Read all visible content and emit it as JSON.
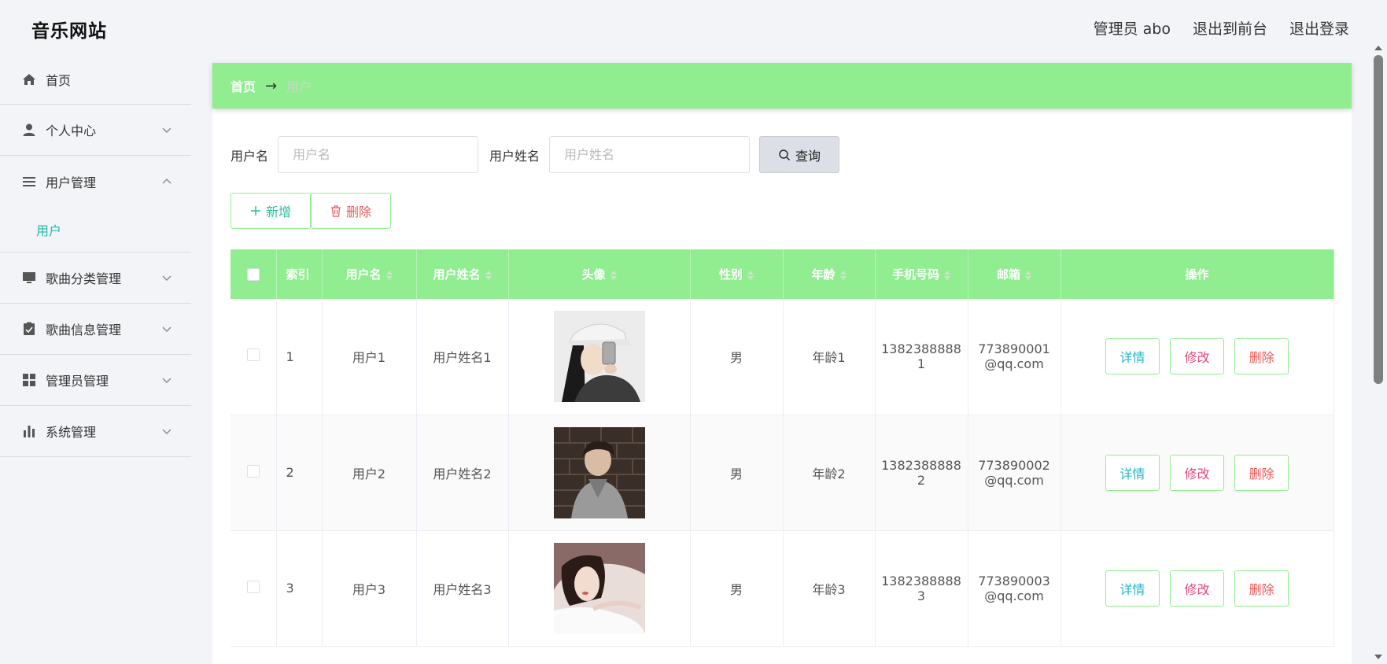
{
  "header": {
    "brand": "音乐网站",
    "admin_label": "管理员 abo",
    "to_front": "退出到前台",
    "logout": "退出登录"
  },
  "sidebar": {
    "items": [
      {
        "label": "首页",
        "icon": "home-icon"
      },
      {
        "label": "个人中心",
        "icon": "person-icon"
      },
      {
        "label": "用户管理",
        "icon": "list-icon",
        "open": true,
        "children": [
          "用户"
        ]
      },
      {
        "label": "歌曲分类管理",
        "icon": "monitor-icon"
      },
      {
        "label": "歌曲信息管理",
        "icon": "clipboard-icon"
      },
      {
        "label": "管理员管理",
        "icon": "grid-icon"
      },
      {
        "label": "系统管理",
        "icon": "bar-chart-icon"
      }
    ]
  },
  "breadcrumb": {
    "home": "首页",
    "arrow": "→",
    "current": "用户"
  },
  "search": {
    "username_label": "用户名",
    "username_placeholder": "用户名",
    "realname_label": "用户姓名",
    "realname_placeholder": "用户姓名",
    "query_button": "查询"
  },
  "actions": {
    "add": "新增",
    "delete": "删除"
  },
  "table": {
    "columns": [
      "索引",
      "用户名",
      "用户姓名",
      "头像",
      "性别",
      "年龄",
      "手机号码",
      "邮箱",
      "操作"
    ],
    "rows": [
      {
        "index": "1",
        "username": "用户1",
        "realname": "用户姓名1",
        "gender": "男",
        "age": "年龄1",
        "phone_a": "1382388888",
        "phone_b": "1",
        "email_a": "773890001",
        "email_b": "@qq.com"
      },
      {
        "index": "2",
        "username": "用户2",
        "realname": "用户姓名2",
        "gender": "男",
        "age": "年龄2",
        "phone_a": "1382388888",
        "phone_b": "2",
        "email_a": "773890002",
        "email_b": "@qq.com"
      },
      {
        "index": "3",
        "username": "用户3",
        "realname": "用户姓名3",
        "gender": "男",
        "age": "年龄3",
        "phone_a": "1382388888",
        "phone_b": "3",
        "email_a": "773890003",
        "email_b": "@qq.com"
      }
    ],
    "op_detail": "详情",
    "op_edit": "修改",
    "op_delete": "删除"
  },
  "colors": {
    "accent_green": "#90ee90",
    "teal": "#22b7a6",
    "danger": "#f05a5a",
    "pink": "#e0487d"
  }
}
